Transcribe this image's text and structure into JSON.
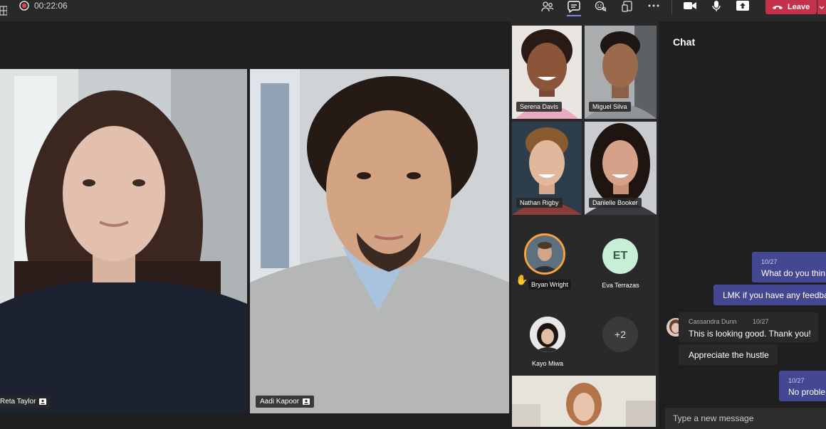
{
  "toolbar": {
    "timer": "00:22:06",
    "leave_label": "Leave",
    "accent": "#c4314b"
  },
  "stage": {
    "participants": [
      {
        "name": "Reta Taylor"
      },
      {
        "name": "Aadi Kapoor"
      }
    ]
  },
  "roster": {
    "video_tiles": [
      {
        "name": "Serena Davis"
      },
      {
        "name": "Miguel Silva"
      },
      {
        "name": "Nathan Rigby"
      },
      {
        "name": "Danielle Booker"
      }
    ],
    "avatars": [
      {
        "name": "Bryan Wright",
        "hand_raised": true
      },
      {
        "name": "Eva Terrazas",
        "initials": "ET"
      },
      {
        "name": "Kayo Miwa"
      },
      {
        "overflow": "+2"
      }
    ]
  },
  "chat": {
    "title": "Chat",
    "messages": [
      {
        "time": "10/27",
        "text": "What do you thin"
      },
      {
        "text": "LMK if you have any feedbac"
      },
      {
        "sender": "Cassandra Dunn",
        "time": "10/27",
        "text": "This is looking good. Thank you!"
      },
      {
        "text": "Appreciate the hustle"
      },
      {
        "time": "10/27",
        "text": "No proble"
      }
    ],
    "composer_placeholder": "Type a new message"
  }
}
